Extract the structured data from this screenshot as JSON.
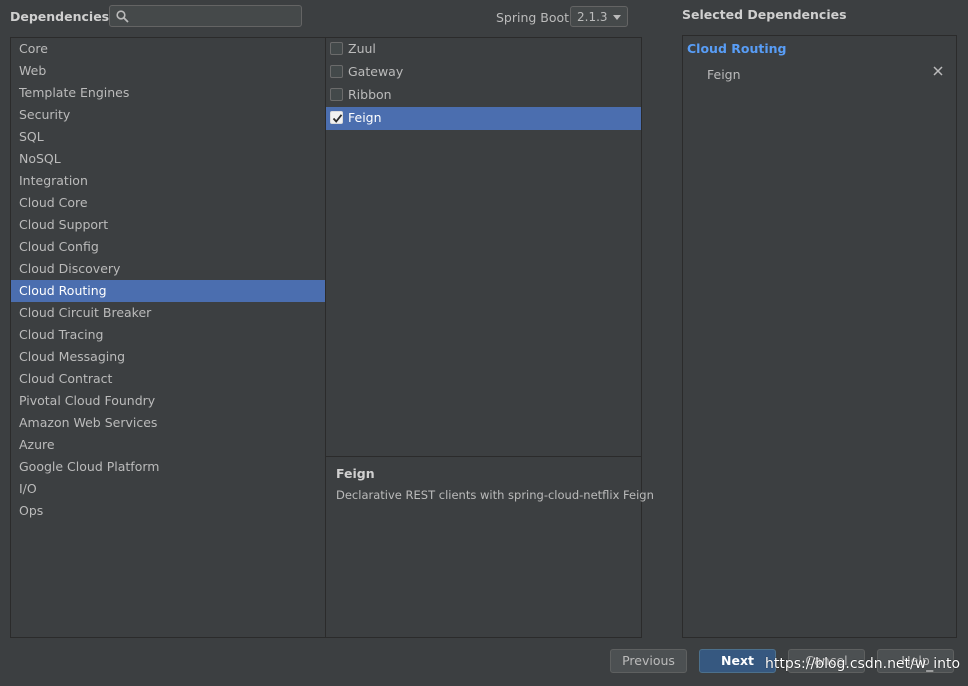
{
  "header": {
    "title": "Dependencies",
    "search_placeholder": "",
    "search_value": "",
    "spring_boot_label": "Spring Boot",
    "spring_boot_version": "2.1.3"
  },
  "categories": [
    {
      "label": "Core",
      "selected": false
    },
    {
      "label": "Web",
      "selected": false
    },
    {
      "label": "Template Engines",
      "selected": false
    },
    {
      "label": "Security",
      "selected": false
    },
    {
      "label": "SQL",
      "selected": false
    },
    {
      "label": "NoSQL",
      "selected": false
    },
    {
      "label": "Integration",
      "selected": false
    },
    {
      "label": "Cloud Core",
      "selected": false
    },
    {
      "label": "Cloud Support",
      "selected": false
    },
    {
      "label": "Cloud Config",
      "selected": false
    },
    {
      "label": "Cloud Discovery",
      "selected": false
    },
    {
      "label": "Cloud Routing",
      "selected": true
    },
    {
      "label": "Cloud Circuit Breaker",
      "selected": false
    },
    {
      "label": "Cloud Tracing",
      "selected": false
    },
    {
      "label": "Cloud Messaging",
      "selected": false
    },
    {
      "label": "Cloud Contract",
      "selected": false
    },
    {
      "label": "Pivotal Cloud Foundry",
      "selected": false
    },
    {
      "label": "Amazon Web Services",
      "selected": false
    },
    {
      "label": "Azure",
      "selected": false
    },
    {
      "label": "Google Cloud Platform",
      "selected": false
    },
    {
      "label": "I/O",
      "selected": false
    },
    {
      "label": "Ops",
      "selected": false
    }
  ],
  "dependencies": [
    {
      "label": "Zuul",
      "checked": false,
      "selected": false
    },
    {
      "label": "Gateway",
      "checked": false,
      "selected": false
    },
    {
      "label": "Ribbon",
      "checked": false,
      "selected": false
    },
    {
      "label": "Feign",
      "checked": true,
      "selected": true
    }
  ],
  "description": {
    "title": "Feign",
    "text": "Declarative REST clients with spring-cloud-netflix Feign"
  },
  "selected_panel": {
    "header": "Selected Dependencies",
    "group": "Cloud Routing",
    "items": [
      {
        "label": "Feign"
      }
    ]
  },
  "buttons": {
    "previous": "Previous",
    "next": "Next",
    "cancel": "Cancel",
    "help": "Help"
  },
  "watermark": "https://blog.csdn.net/w_into",
  "colors": {
    "background": "#3c3f41",
    "selection": "#4b6eaf",
    "group_heading": "#589df6",
    "default_button": "#365880"
  }
}
